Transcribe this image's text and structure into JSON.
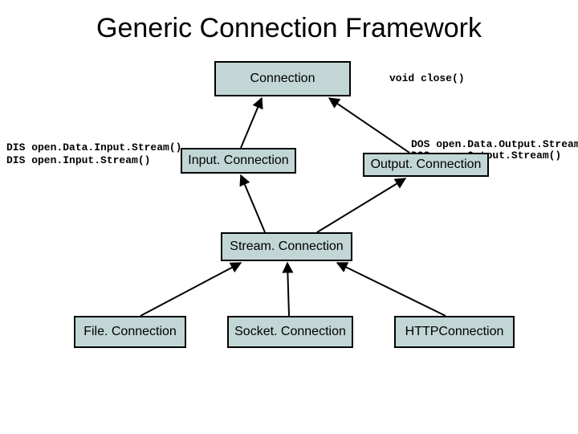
{
  "title": "Generic Connection Framework",
  "boxes": {
    "connection": "Connection",
    "input": "Input. Connection",
    "output": "Output. Connection",
    "stream": "Stream. Connection",
    "file": "File. Connection",
    "socket": "Socket. Connection",
    "http": "HTTPConnection"
  },
  "annotations": {
    "close": "void close()",
    "dis1": "DIS open.Data.Input.Stream()",
    "dis2": "DIS open.Input.Stream()",
    "dos1": "DOS open.Data.Output.Stream(",
    "dos2": "DOS open.Output.Stream()"
  }
}
